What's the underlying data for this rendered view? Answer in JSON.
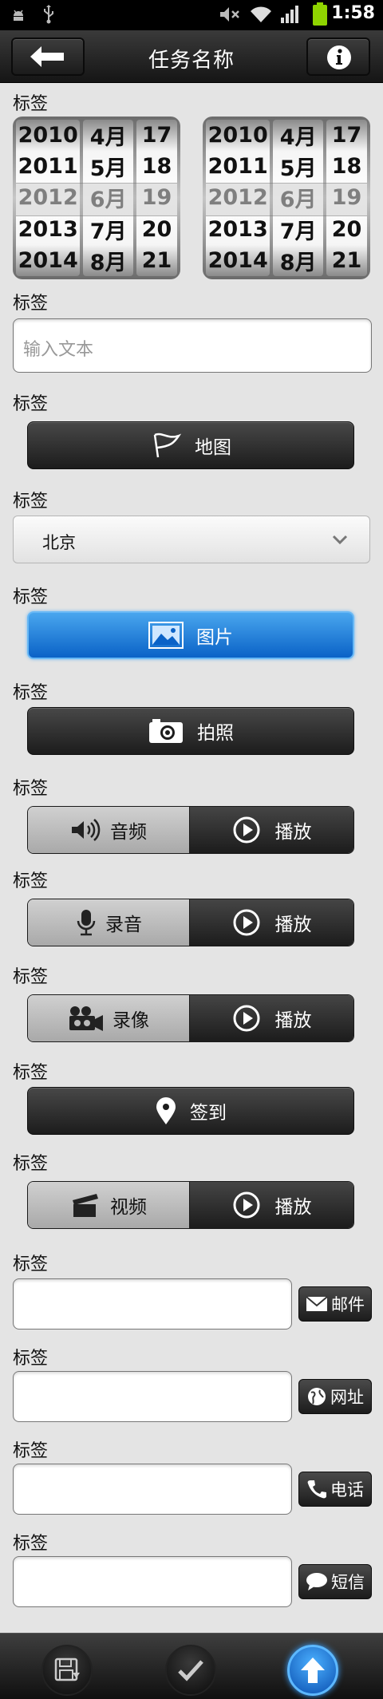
{
  "status_bar": {
    "time": "1:58",
    "icons": [
      "android-debug-icon",
      "usb-icon",
      "mute-icon",
      "wifi-icon",
      "signal-icon",
      "battery-icon"
    ]
  },
  "nav": {
    "title": "任务名称",
    "back_icon": "back-arrow-icon",
    "info_icon": "info-icon"
  },
  "pickers": [
    {
      "years": [
        "2010",
        "2011",
        "2012",
        "2013",
        "2014"
      ],
      "months": [
        "4月",
        "5月",
        "6月",
        "7月",
        "8月"
      ],
      "days": [
        "17",
        "18",
        "19",
        "20",
        "21"
      ]
    },
    {
      "years": [
        "2010",
        "2011",
        "2012",
        "2013",
        "2014"
      ],
      "months": [
        "4月",
        "5月",
        "6月",
        "7月",
        "8月"
      ],
      "days": [
        "17",
        "18",
        "19",
        "20",
        "21"
      ]
    }
  ],
  "labels": {
    "date": "标签",
    "text": "标签",
    "map": "标签",
    "city": "标签",
    "image": "标签",
    "photo": "标签",
    "audio": "标签",
    "record": "标签",
    "video_rec": "标签",
    "checkin": "标签",
    "video": "标签",
    "email": "标签",
    "web": "标签",
    "phone": "标签",
    "sms": "标签"
  },
  "text_input": {
    "placeholder": "输入文本"
  },
  "buttons": {
    "map": "地图",
    "image": "图片",
    "photo": "拍照",
    "checkin": "签到"
  },
  "select": {
    "value": "北京"
  },
  "split_buttons": {
    "audio": {
      "left": "音频",
      "right": "播放"
    },
    "record": {
      "left": "录音",
      "right": "播放"
    },
    "video_rec": {
      "left": "录像",
      "right": "播放"
    },
    "video": {
      "left": "视频",
      "right": "播放"
    }
  },
  "side_buttons": {
    "email": "邮件",
    "web": "网址",
    "phone": "电话",
    "sms": "短信"
  },
  "colors": {
    "accent_blue": "#0a62c7",
    "dark_button": "#1c1c1c",
    "background": "#e4e4e4"
  },
  "bottom_bar": {
    "icons": [
      "save-icon",
      "check-icon",
      "upload-icon"
    ]
  }
}
